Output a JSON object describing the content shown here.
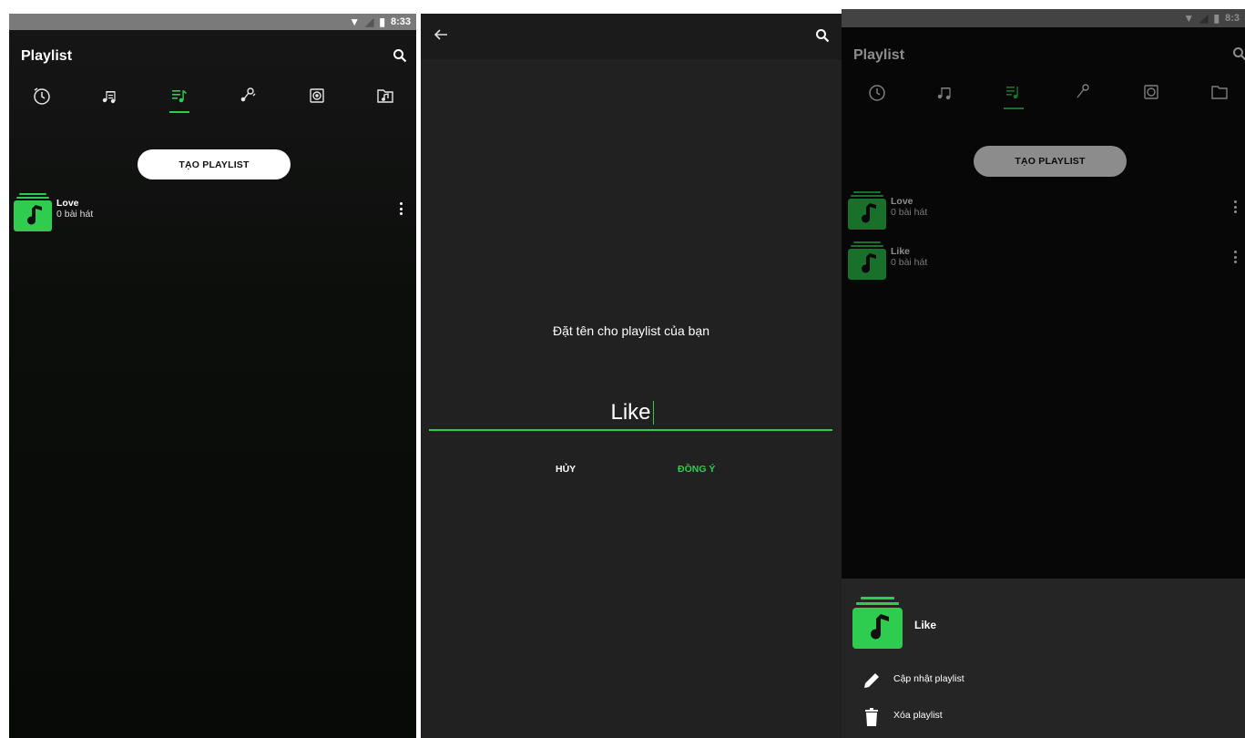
{
  "colors": {
    "accent": "#2ecc4f",
    "background": "#0d0d0d",
    "sheet": "#252525",
    "text": "#ffffff"
  },
  "screen1": {
    "status": {
      "time": "8:33"
    },
    "title": "Playlist",
    "tabs": [
      {
        "icon": "recent-history-icon"
      },
      {
        "icon": "songs-icon"
      },
      {
        "icon": "playlist-icon",
        "active": true
      },
      {
        "icon": "artist-icon"
      },
      {
        "icon": "album-icon"
      },
      {
        "icon": "folder-icon"
      }
    ],
    "create_button": "TẠO PLAYLIST",
    "playlists": [
      {
        "name": "Love",
        "count": "0 bài hát"
      }
    ]
  },
  "screen2": {
    "dialog_title": "Đặt tên cho playlist của bạn",
    "input_value": "Like",
    "cancel_label": "HỦY",
    "confirm_label": "ĐỒNG Ý"
  },
  "screen3": {
    "status": {
      "time": "8:3"
    },
    "title": "Playlist",
    "create_button": "TẠO PLAYLIST",
    "playlists": [
      {
        "name": "Love",
        "count": "0 bài hát"
      },
      {
        "name": "Like",
        "count": "0 bài hát"
      }
    ],
    "sheet": {
      "title": "Like",
      "items": [
        {
          "label": "Cập nhật playlist",
          "icon": "pencil-icon"
        },
        {
          "label": "Xóa playlist",
          "icon": "trash-icon"
        }
      ]
    }
  }
}
